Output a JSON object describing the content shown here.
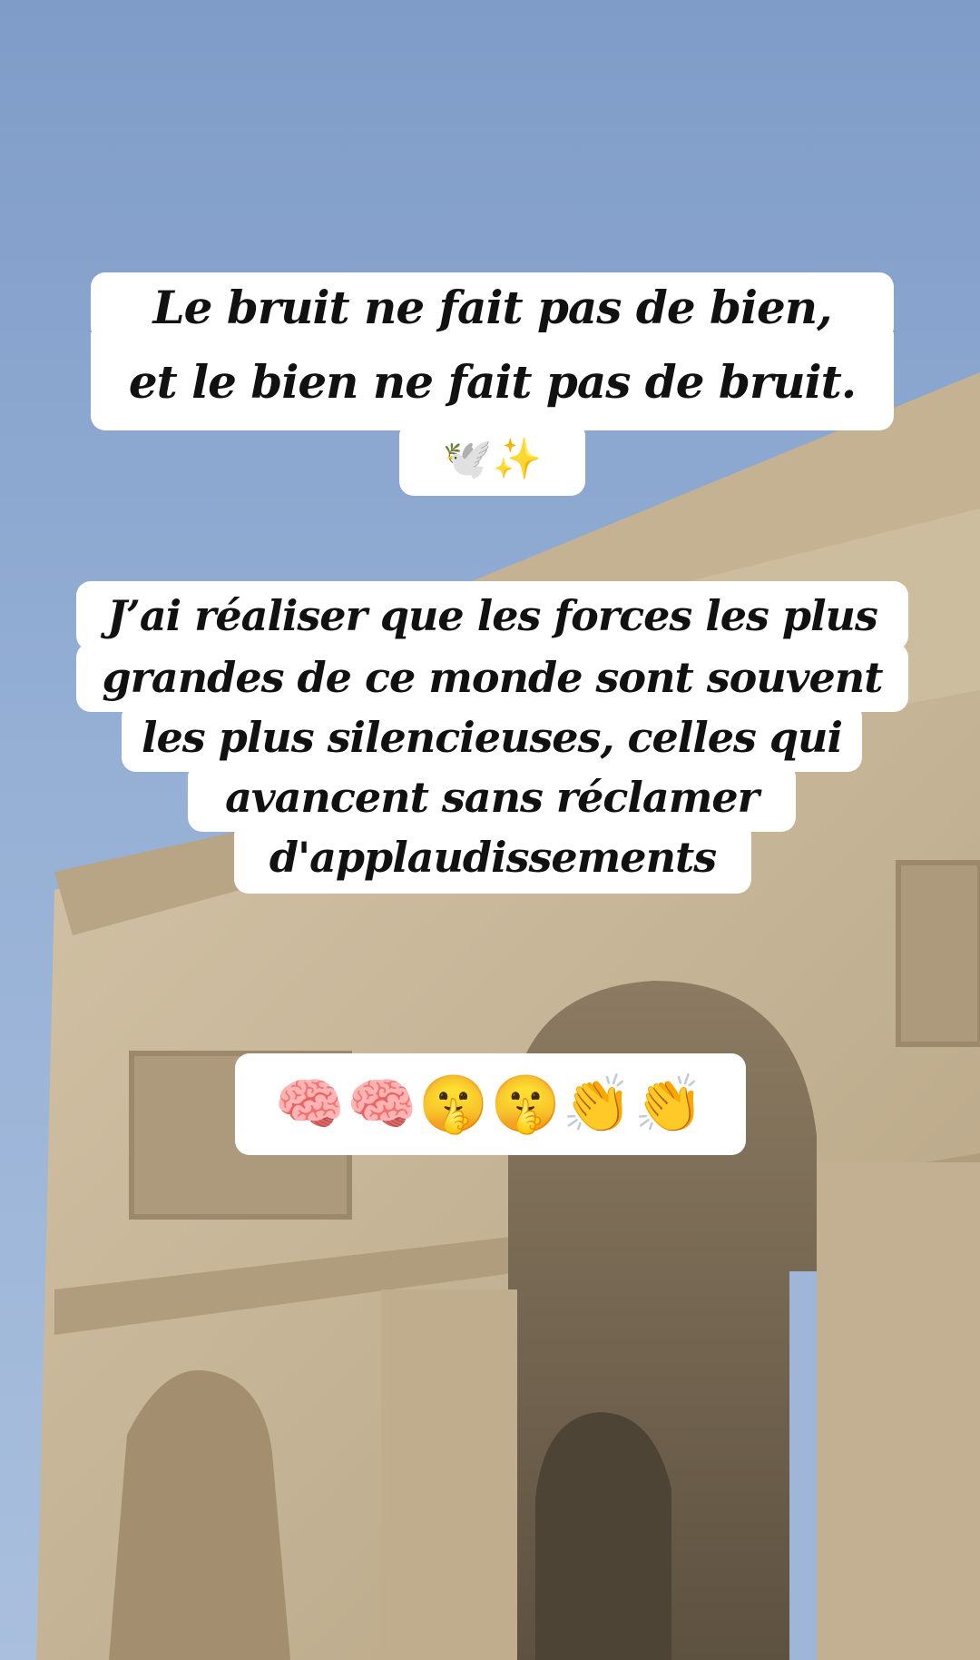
{
  "story": {
    "quote_lines": [
      "Le bruit ne fait pas de bien,",
      "et le bien ne fait pas de bruit."
    ],
    "quote_emojis": "🕊️✨",
    "reflection_lines": [
      "J’ai réaliser que les forces les plus",
      "grandes de ce monde sont souvent",
      "les plus silencieuses, celles qui",
      "avancent sans réclamer",
      "d'applaudissements"
    ],
    "reaction_emojis": "🧠🧠🤫🤫👏👏"
  },
  "scene": {
    "subject": "arc-de-triomphe",
    "sky_color": "#8ea9cf",
    "stone_color": "#c9b79a"
  }
}
